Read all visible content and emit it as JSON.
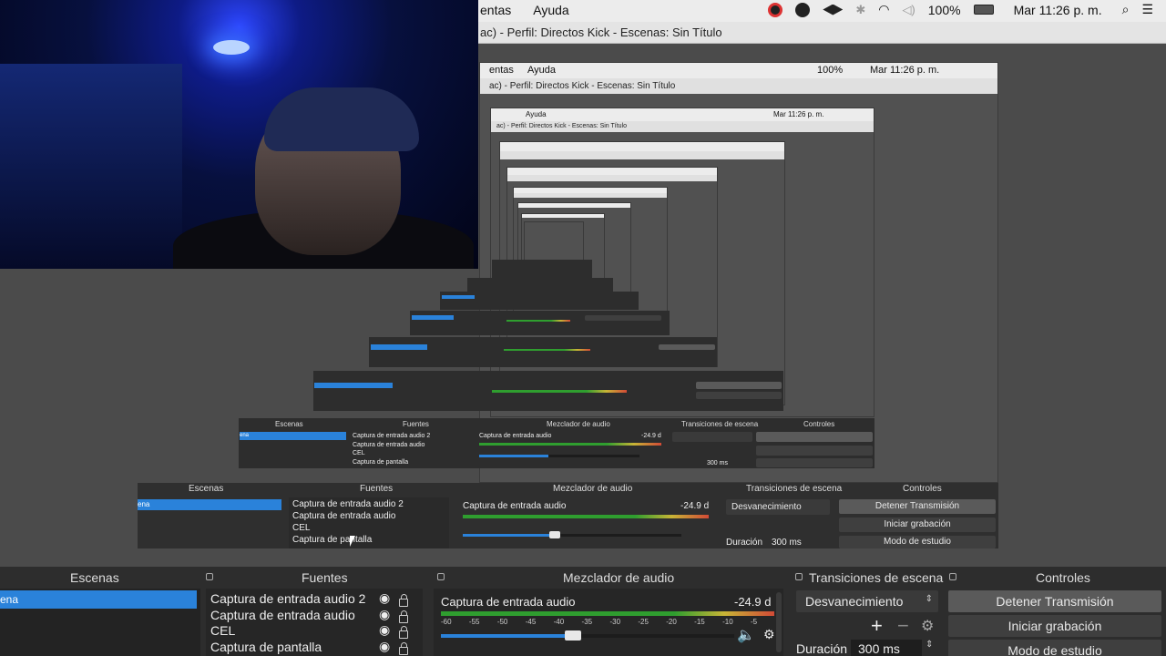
{
  "menubar": {
    "menus": [
      "entas",
      "Ayuda"
    ],
    "battery": "100%",
    "clock": "Mar 11:26 p. m."
  },
  "window": {
    "title": "ac) - Perfil: Directos Kick - Escenas: Sin Título"
  },
  "docks": {
    "scenes_header": "Escenas",
    "sources_header": "Fuentes",
    "mixer_header": "Mezclador de audio",
    "transitions_header": "Transiciones de escena",
    "controls_header": "Controles",
    "scene_selected": "ena",
    "sources": [
      "Captura de entrada audio 2",
      "Captura de entrada audio",
      "CEL",
      "Captura de pantalla"
    ],
    "mixer_source": "Captura de entrada audio",
    "mixer_level": "-24.9 d",
    "mixer_ticks": [
      "-60",
      "-55",
      "-50",
      "-45",
      "-40",
      "-35",
      "-30",
      "-25",
      "-20",
      "-15",
      "-10",
      "-5"
    ],
    "volume_fraction": 0.45,
    "transition": "Desvanecimiento",
    "duration_label": "Duración",
    "duration_value": "300 ms",
    "stop_stream": "Detener Transmisión",
    "start_recording": "Iniciar grabación",
    "studio_mode": "Modo de estudio"
  },
  "nested": {
    "title": "ac) - Perfil: Directos Kick - Escenas: Sin Título",
    "menus": [
      "entas",
      "Ayuda"
    ],
    "clock": "Mar 11:26 p. m.",
    "battery": "100%",
    "level": "-24.9 d",
    "mixer_source": "Captura de entrada audio",
    "scene_selected": "ena",
    "duration_value": "300 ms"
  }
}
